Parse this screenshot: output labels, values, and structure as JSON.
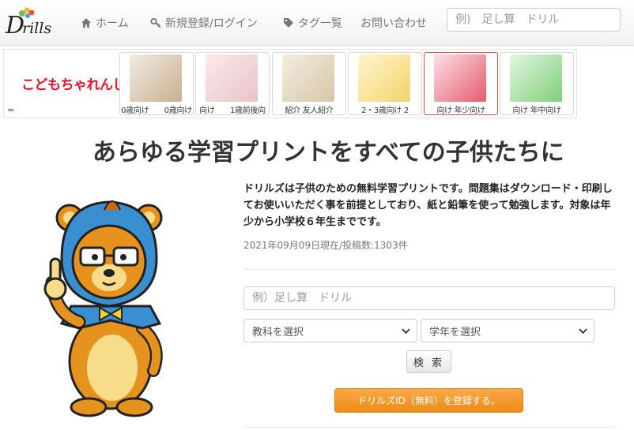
{
  "navbar": {
    "brand": "Drills",
    "links": [
      {
        "label": "ホーム",
        "icon": "home-icon"
      },
      {
        "label": "新規登録/ログイン",
        "icon": "key-icon"
      },
      {
        "label": "タグ一覧",
        "icon": "tag-icon"
      },
      {
        "label": "お問い合わせ",
        "icon": ""
      }
    ],
    "search_placeholder": "例)　足し算　ドリル"
  },
  "banner": {
    "brand": "こどもちゃれんじ",
    "marker": "=",
    "cards": [
      {
        "caption": "0歳向け",
        "color": "#c9b08f"
      },
      {
        "caption": "1歳前後向",
        "color": "#e8c3c7"
      },
      {
        "caption": "友人紹介",
        "color": "#d7c6a8"
      },
      {
        "caption": "2・3歳向け 2",
        "color": "#f2d36a"
      },
      {
        "caption": "年少向け",
        "color": "#e55a6e"
      },
      {
        "caption": "年中向け",
        "color": "#7fcf7a"
      }
    ],
    "captions": {
      "c1": "0歳向け　　0歳向け",
      "c2": "向け　　1歳前後向",
      "c3": "紹介 友人紹介",
      "c4": "2・3歳向け 2",
      "c5": "向け 年少向け",
      "c6": "向け 年中向け"
    }
  },
  "headline": "あらゆる学習プリントをすべての子供たちに",
  "intro": "ドリルズは子供のための無料学習プリントです。問題集はダウンロード・印刷してお使いいただく事を前提としており、紙と鉛筆を使って勉強します。対象は年少から小学校６年生までです。",
  "meta": "2021年09月09日現在/投稿数:1303件",
  "search": {
    "placeholder": "例）足し算　ドリル",
    "subject_select": "教科を選択",
    "grade_select": "学年を選択",
    "submit": "検 索"
  },
  "register_button": "ドリルズID（無料）を登録する。",
  "colors": {
    "accent_orange": "#f0951f",
    "brand_red": "#e4142c",
    "mascot_hood": "#3a8fd1"
  }
}
